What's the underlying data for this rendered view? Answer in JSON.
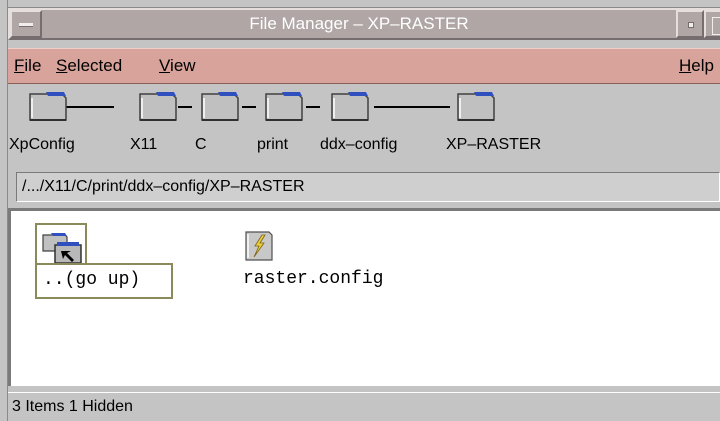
{
  "window": {
    "title": "File Manager – XP–RASTER"
  },
  "menubar": {
    "file": {
      "mnemonic": "F",
      "rest": "ile"
    },
    "selected": {
      "mnemonic": "S",
      "rest": "elected"
    },
    "view": {
      "mnemonic": "V",
      "rest": "iew"
    },
    "help": {
      "mnemonic": "H",
      "rest": "elp"
    }
  },
  "path_segments": [
    "XpConfig",
    "X11",
    "C",
    "print",
    "ddx–config",
    "XP–RASTER"
  ],
  "path_field": {
    "value": "/.../X11/C/print/ddx–config/XP–RASTER"
  },
  "files": [
    {
      "name": "..(go up)",
      "icon": "folder-up-icon"
    },
    {
      "name": "raster.config",
      "icon": "data-file-icon"
    }
  ],
  "status": {
    "text": "3 Items 1 Hidden"
  },
  "colors": {
    "menubar": "#d8a39a",
    "titlebar": "#b0a6a6",
    "folder": "#c0c0c0",
    "folder_tab": "#3050c0"
  }
}
